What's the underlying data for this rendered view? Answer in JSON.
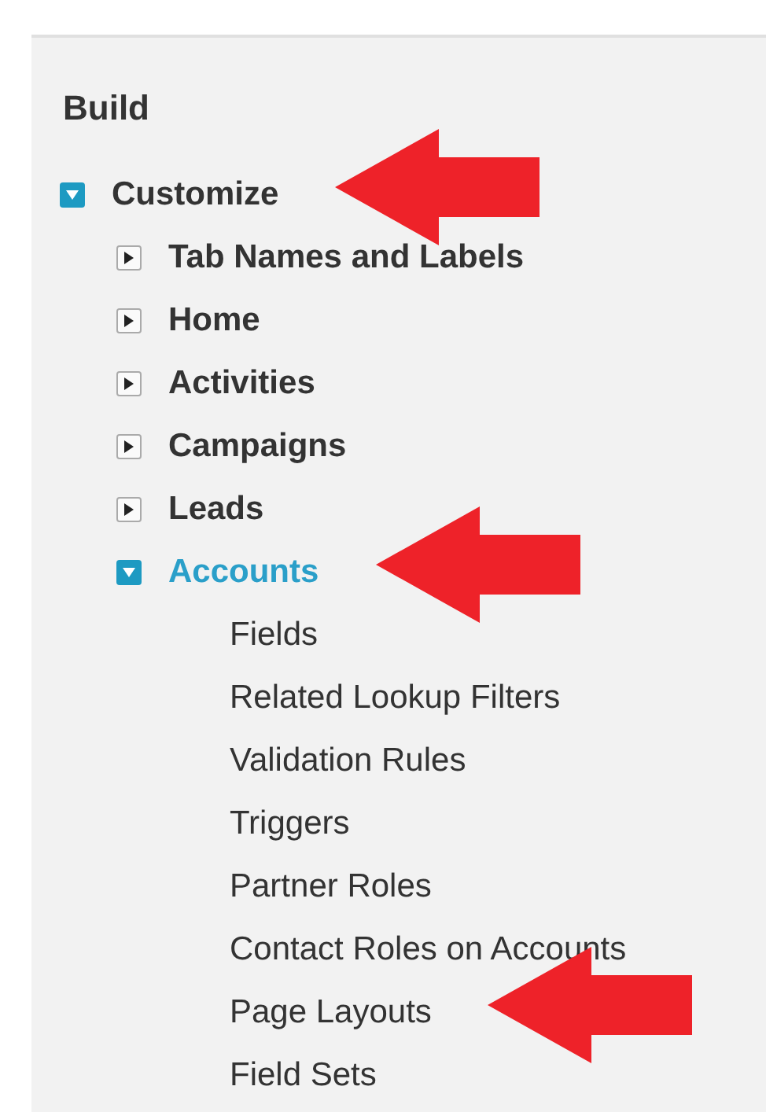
{
  "section": {
    "title": "Build"
  },
  "tree": [
    {
      "label": "Customize",
      "kind": "folder",
      "expanded": true,
      "selected": false,
      "arrow": true,
      "children": [
        {
          "label": "Tab Names and Labels",
          "kind": "folder",
          "expanded": false,
          "selected": false,
          "arrow": false
        },
        {
          "label": "Home",
          "kind": "folder",
          "expanded": false,
          "selected": false,
          "arrow": false
        },
        {
          "label": "Activities",
          "kind": "folder",
          "expanded": false,
          "selected": false,
          "arrow": false
        },
        {
          "label": "Campaigns",
          "kind": "folder",
          "expanded": false,
          "selected": false,
          "arrow": false
        },
        {
          "label": "Leads",
          "kind": "folder",
          "expanded": false,
          "selected": false,
          "arrow": false
        },
        {
          "label": "Accounts",
          "kind": "folder",
          "expanded": true,
          "selected": true,
          "arrow": true,
          "children": [
            {
              "label": "Fields",
              "kind": "leaf",
              "selected": false,
              "arrow": false
            },
            {
              "label": "Related Lookup Filters",
              "kind": "leaf",
              "selected": false,
              "arrow": false
            },
            {
              "label": "Validation Rules",
              "kind": "leaf",
              "selected": false,
              "arrow": false
            },
            {
              "label": "Triggers",
              "kind": "leaf",
              "selected": false,
              "arrow": false
            },
            {
              "label": "Partner Roles",
              "kind": "leaf",
              "selected": false,
              "arrow": false
            },
            {
              "label": "Contact Roles on Accounts",
              "kind": "leaf",
              "selected": false,
              "arrow": false
            },
            {
              "label": "Page Layouts",
              "kind": "leaf",
              "selected": false,
              "arrow": true
            },
            {
              "label": "Field Sets",
              "kind": "leaf",
              "selected": false,
              "arrow": false
            }
          ]
        }
      ]
    }
  ]
}
